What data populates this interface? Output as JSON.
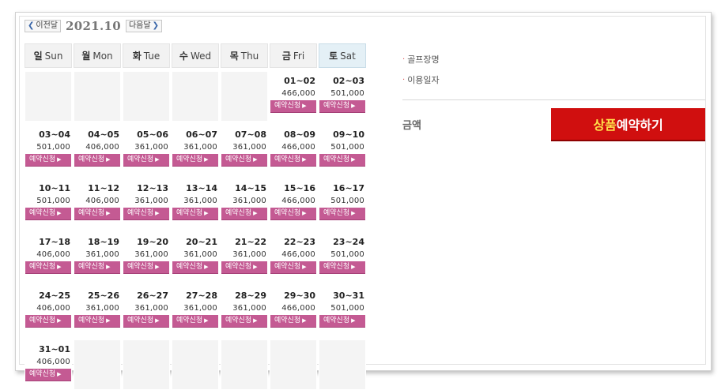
{
  "header": {
    "prev_label": "이전달",
    "month": "2021.10",
    "next_label": "다음달"
  },
  "weekdays": [
    {
      "ko": "일",
      "en": "Sun"
    },
    {
      "ko": "월",
      "en": "Mon"
    },
    {
      "ko": "화",
      "en": "Tue"
    },
    {
      "ko": "수",
      "en": "Wed"
    },
    {
      "ko": "목",
      "en": "Thu"
    },
    {
      "ko": "금",
      "en": "Fri"
    },
    {
      "ko": "토",
      "en": "Sat"
    }
  ],
  "book_label": "예약신청",
  "weeks": [
    [
      null,
      null,
      null,
      null,
      null,
      {
        "range": "01~02",
        "price": "466,000"
      },
      {
        "range": "02~03",
        "price": "501,000"
      }
    ],
    [
      {
        "range": "03~04",
        "price": "501,000"
      },
      {
        "range": "04~05",
        "price": "406,000"
      },
      {
        "range": "05~06",
        "price": "361,000"
      },
      {
        "range": "06~07",
        "price": "361,000"
      },
      {
        "range": "07~08",
        "price": "361,000"
      },
      {
        "range": "08~09",
        "price": "466,000"
      },
      {
        "range": "09~10",
        "price": "501,000"
      }
    ],
    [
      {
        "range": "10~11",
        "price": "501,000"
      },
      {
        "range": "11~12",
        "price": "406,000"
      },
      {
        "range": "12~13",
        "price": "361,000"
      },
      {
        "range": "13~14",
        "price": "361,000"
      },
      {
        "range": "14~15",
        "price": "361,000"
      },
      {
        "range": "15~16",
        "price": "466,000"
      },
      {
        "range": "16~17",
        "price": "501,000"
      }
    ],
    [
      {
        "range": "17~18",
        "price": "406,000"
      },
      {
        "range": "18~19",
        "price": "361,000"
      },
      {
        "range": "19~20",
        "price": "361,000"
      },
      {
        "range": "20~21",
        "price": "361,000"
      },
      {
        "range": "21~22",
        "price": "361,000"
      },
      {
        "range": "22~23",
        "price": "466,000"
      },
      {
        "range": "23~24",
        "price": "501,000"
      }
    ],
    [
      {
        "range": "24~25",
        "price": "406,000"
      },
      {
        "range": "25~26",
        "price": "361,000"
      },
      {
        "range": "26~27",
        "price": "361,000"
      },
      {
        "range": "27~28",
        "price": "361,000"
      },
      {
        "range": "28~29",
        "price": "361,000"
      },
      {
        "range": "29~30",
        "price": "466,000"
      },
      {
        "range": "30~31",
        "price": "501,000"
      }
    ],
    [
      {
        "range": "31~01",
        "price": "406,000"
      },
      null,
      null,
      null,
      null,
      null,
      null
    ]
  ],
  "info": {
    "golf_name_label": "골프장명",
    "use_date_label": "이용일자",
    "amount_label": "금액"
  },
  "reserve": {
    "highlight": "상품",
    "rest": "예약하기"
  },
  "colors": {
    "book_button": "#c45a93",
    "reserve_button": "#d00f0f",
    "reserve_highlight": "#ffe04a",
    "saturday_header": "#e4f0f6"
  }
}
